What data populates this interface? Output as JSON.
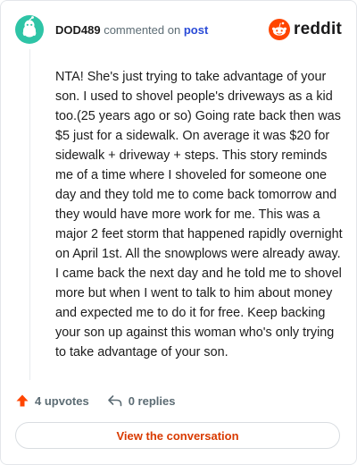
{
  "header": {
    "username": "DOD489",
    "action_text": "commented on",
    "target_link": "post",
    "brand_name": "reddit"
  },
  "comment": {
    "text": "NTA! She's just trying to take advantage of your son. I used to shovel people's driveways as a kid too.(25 years ago or so) Going rate back then was $5 just for a sidewalk. On average it was $20 for sidewalk + driveway + steps. This story reminds me of a time where I shoveled for someone one day and they told me to come back tomorrow and they would have more work for me. This was a major 2 feet storm that happened rapidly overnight on April 1st. All the snowplows were already away. I came back the next day and he told me to shovel more but when I went to talk to him about money and expected me to do it for free. Keep backing your son up against this woman who's only trying to take advantage of your son."
  },
  "actions": {
    "upvotes_label": "4 upvotes",
    "replies_label": "0 replies"
  },
  "cta": {
    "label": "View the conversation"
  },
  "colors": {
    "avatar_bg": "#2ec4a6",
    "link_blue": "#2a4bd7",
    "reddit_orange": "#ff4500",
    "cta_text": "#d93a00"
  },
  "icons": {
    "avatar": "snoo-avatar-icon",
    "logo": "reddit-logo-icon",
    "upvote": "upvote-arrow-icon",
    "reply": "reply-arrow-icon"
  }
}
